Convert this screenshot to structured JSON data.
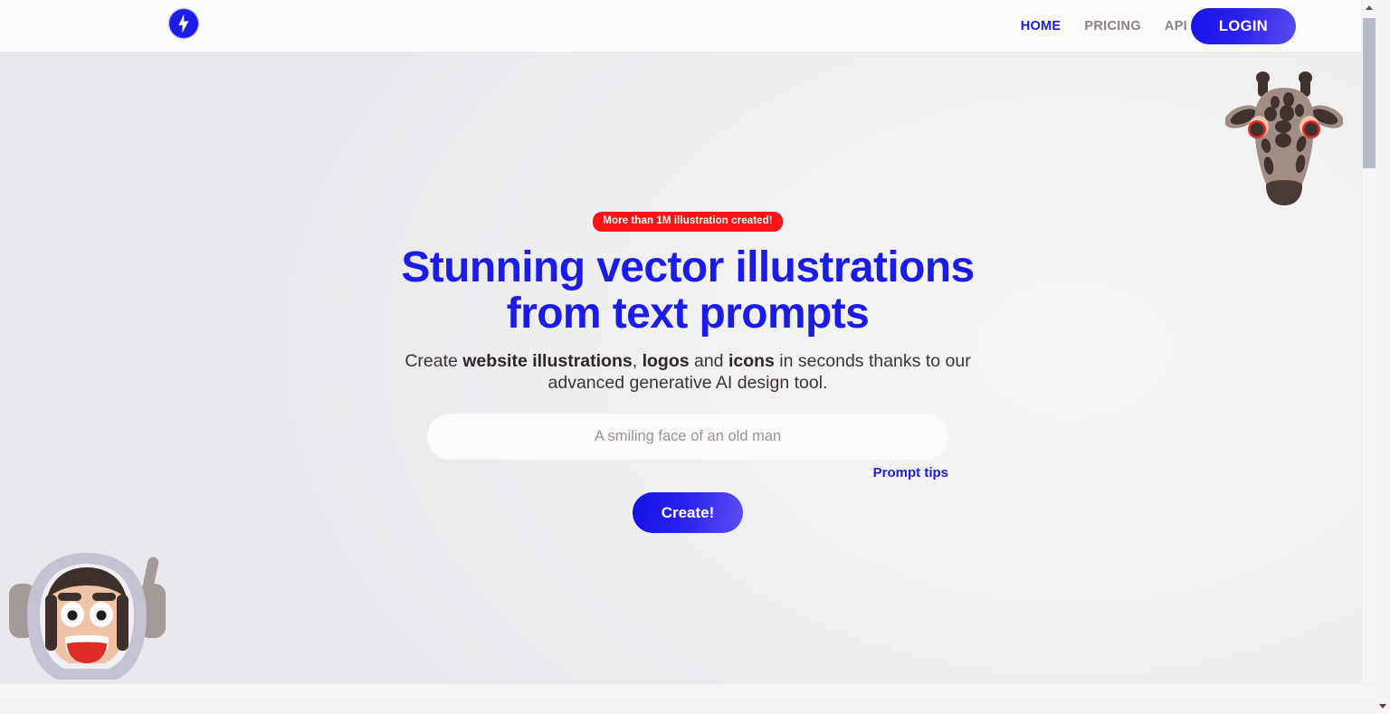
{
  "header": {
    "logo_icon": "lightning-bolt-logo",
    "nav": [
      {
        "label": "HOME",
        "active": true
      },
      {
        "label": "PRICING",
        "active": false
      },
      {
        "label": "API",
        "active": false
      }
    ],
    "login_label": "LOGIN"
  },
  "hero": {
    "badge": "More than 1M illustration created!",
    "headline": "Stunning vector illustrations from text prompts",
    "subhead": {
      "part1": "Create ",
      "bold1": "website illustrations",
      "part2": ", ",
      "bold2": "logos",
      "part3": " and ",
      "bold3": "icons",
      "part4": " in seconds thanks to our advanced generative AI design tool."
    },
    "prompt_placeholder": "A smiling face of an old man",
    "prompt_value": "",
    "tips_label": "Prompt tips",
    "create_label": "Create!"
  },
  "illustrations": {
    "giraffe": "giraffe-head-illustration",
    "astronaut": "astronaut-face-illustration"
  },
  "colors": {
    "brand_blue": "#1c1ce8",
    "badge_red": "#fa1416",
    "nav_inactive": "#8a8186",
    "text_dark": "#3c3338",
    "giraffe_body": "#a08d85",
    "giraffe_spot": "#40322e",
    "giraffe_eye_ring": "#e02b28",
    "astronaut_helmet": "#c3c3d2",
    "astronaut_skin": "#f0c3a7",
    "astronaut_hair": "#3d2f2b",
    "astronaut_mouth": "#e02b28"
  },
  "scrollbars": {
    "vertical_up_icon": "caret-up-icon",
    "vertical_down_icon": "caret-down-icon",
    "thumb_position_percent": 3
  }
}
